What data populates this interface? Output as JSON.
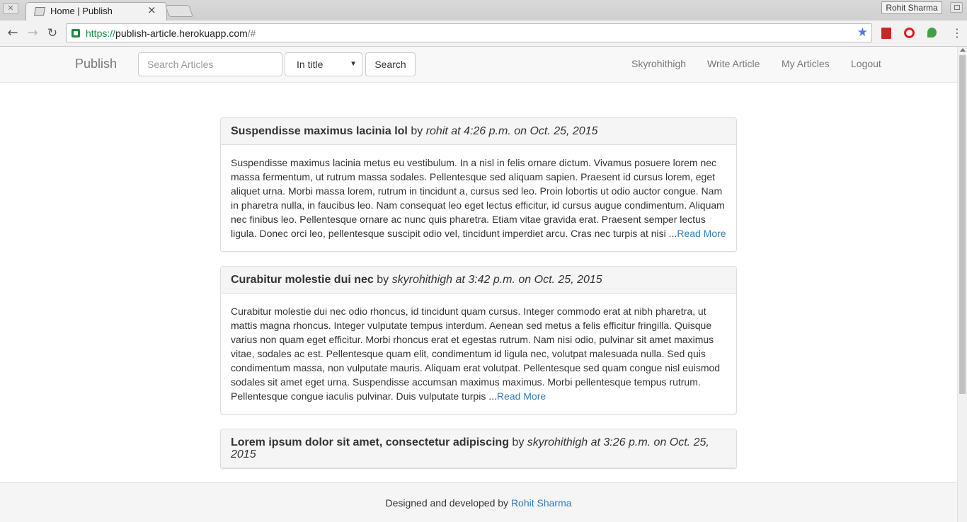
{
  "browser": {
    "tab_title": "Home | Publish",
    "tab_close": "×",
    "profile_name": "Rohit Sharma",
    "url_scheme": "https://",
    "url_host": "publish-article.herokuapp.com",
    "url_path": "/#"
  },
  "navbar": {
    "brand": "Publish",
    "search_placeholder": "Search Articles",
    "search_scope": "In title",
    "search_button": "Search",
    "links": [
      "Skyrohithigh",
      "Write Article",
      "My Articles",
      "Logout"
    ]
  },
  "articles": [
    {
      "title": "Suspendisse maximus lacinia lol",
      "by": "by",
      "meta": "rohit at 4:26 p.m. on Oct. 25, 2015",
      "excerpt": "Suspendisse maximus lacinia metus eu vestibulum. In a nisl in felis ornare dictum. Vivamus posuere lorem nec massa fermentum, ut rutrum massa sodales. Pellentesque sed aliquam sapien. Praesent id cursus lorem, eget aliquet urna. Morbi massa lorem, rutrum in tincidunt a, cursus sed leo. Proin lobortis ut odio auctor congue. Nam in pharetra nulla, in faucibus leo. Nam consequat leo eget lectus efficitur, id cursus augue condimentum. Aliquam nec finibus leo. Pellentesque ornare ac nunc quis pharetra. Etiam vitae gravida erat. Praesent semper lectus ligula. Donec orci leo, pellentesque suscipit odio vel, tincidunt imperdiet arcu. Cras nec turpis at nisi ...",
      "read_more": "Read More"
    },
    {
      "title": "Curabitur molestie dui nec",
      "by": "by",
      "meta": "skyrohithigh at 3:42 p.m. on Oct. 25, 2015",
      "excerpt": "Curabitur molestie dui nec odio rhoncus, id tincidunt quam cursus. Integer commodo erat at nibh pharetra, ut mattis magna rhoncus. Integer vulputate tempus interdum. Aenean sed metus a felis efficitur fringilla. Quisque varius non quam eget efficitur. Morbi rhoncus erat et egestas rutrum. Nam nisi odio, pulvinar sit amet maximus vitae, sodales ac est. Pellentesque quam elit, condimentum id ligula nec, volutpat malesuada nulla. Sed quis condimentum massa, non vulputate mauris. Aliquam erat volutpat. Pellentesque sed quam congue nisl euismod sodales sit amet eget urna. Suspendisse accumsan maximus maximus. Morbi pellentesque tempus rutrum. Pellentesque congue iaculis pulvinar. Duis vulputate turpis ...",
      "read_more": "Read More"
    },
    {
      "title": "Lorem ipsum dolor sit amet, consectetur adipiscing",
      "by": "by",
      "meta": "skyrohithigh at 3:26 p.m. on Oct. 25, 2015",
      "excerpt": "",
      "read_more": ""
    }
  ],
  "footer": {
    "text": "Designed and developed by",
    "author": "Rohit Sharma"
  },
  "colors": {
    "link": "#337ab7",
    "navbar_bg": "#f8f8f8",
    "secure_green": "#1a8a3c"
  }
}
